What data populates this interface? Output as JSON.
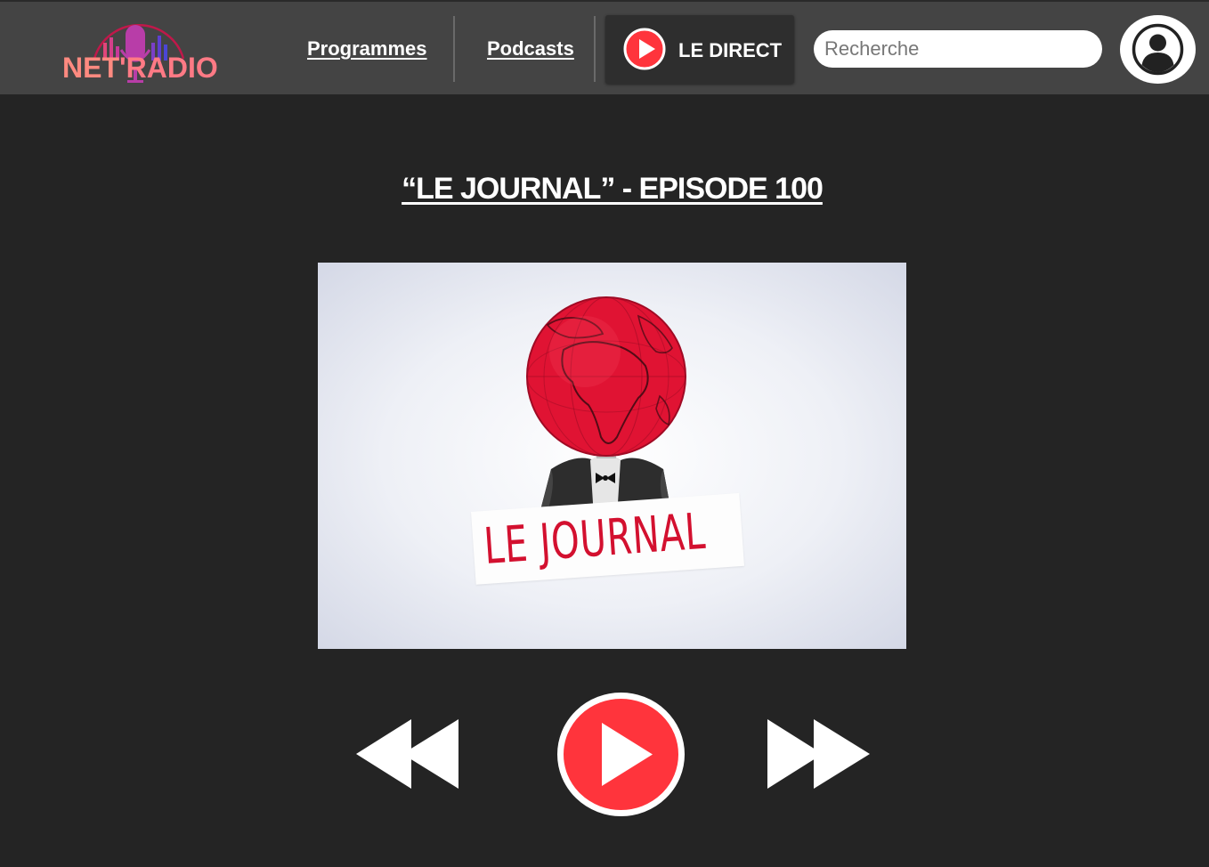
{
  "header": {
    "logo": {
      "part1": "NET",
      "part2": "'RADIO"
    },
    "nav": {
      "programmes": "Programmes",
      "podcasts": "Podcasts"
    },
    "direct": {
      "label": "LE DIRECT",
      "icon": "play-icon"
    },
    "search": {
      "placeholder": "Recherche",
      "value": ""
    },
    "user": {
      "icon": "user-icon"
    }
  },
  "main": {
    "episode_title": "“LE JOURNAL” - EPISODE 100",
    "cover": {
      "banner_text": "LE JOURNAL"
    },
    "controls": {
      "rewind_icon": "rewind-icon",
      "play_icon": "play-icon",
      "forward_icon": "fast-forward-icon"
    }
  },
  "colors": {
    "header_bg": "#444444",
    "page_bg": "#242424",
    "accent_red": "#ff343c",
    "cover_red": "#d3102f"
  }
}
